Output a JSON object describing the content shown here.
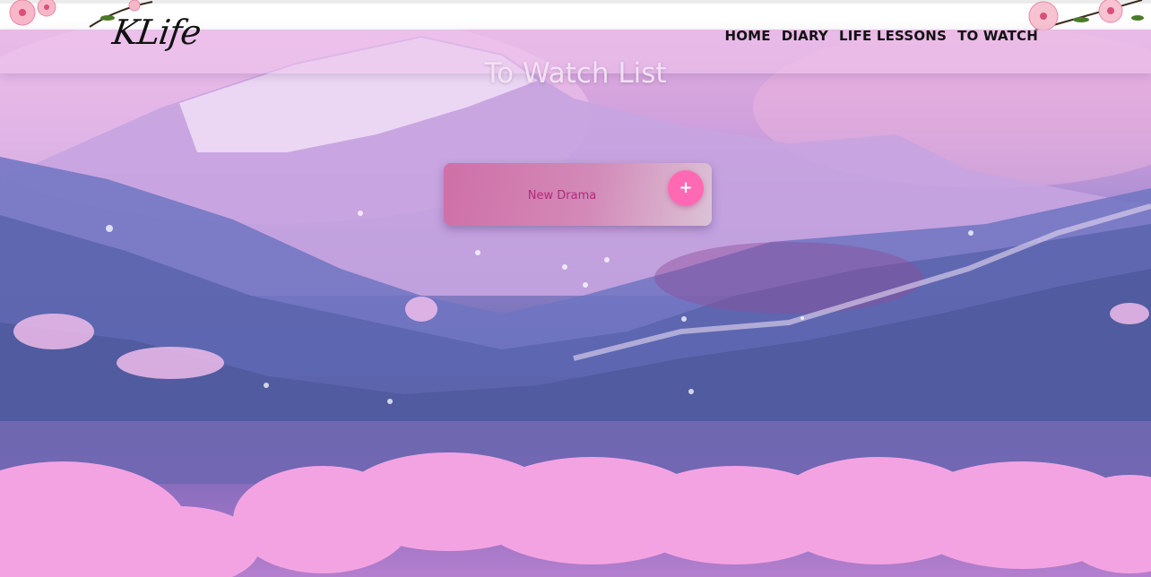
{
  "header": {
    "logo": "KLife",
    "nav": [
      {
        "label": "HOME"
      },
      {
        "label": "DIARY"
      },
      {
        "label": "LIFE LESSONS"
      },
      {
        "label": "TO WATCH"
      }
    ]
  },
  "main": {
    "title": "To Watch List",
    "new_item": {
      "placeholder": "New Drama",
      "add_label": "+"
    }
  },
  "colors": {
    "accent_pink": "#ff69b4",
    "card_text": "#b5287d"
  },
  "icons": {
    "decor_left": "cherry-blossom-icon",
    "decor_right": "cherry-blossom-icon"
  }
}
